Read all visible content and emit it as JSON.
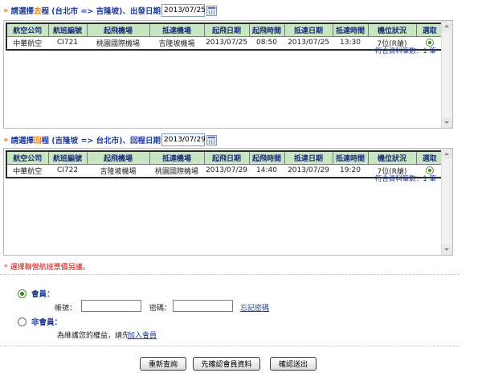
{
  "outbound": {
    "prefix": "請選擇",
    "highlight": "去",
    "suffix": "程 (台北市 => 吉隆坡)、出發日期",
    "date": "2013/07/25",
    "headers": [
      "航空公司",
      "航班編號",
      "起飛機場",
      "抵達機場",
      "起飛日期",
      "起飛時間",
      "抵達日期",
      "抵達時間",
      "機位狀況",
      "選取"
    ],
    "rows": [
      {
        "airline": "中華航空",
        "flight": "CI721",
        "from": "桃園國際機場",
        "to": "吉隆坡機場",
        "dep_date": "2013/07/25",
        "dep_time": "08:50",
        "arr_date": "2013/07/25",
        "arr_time": "13:30",
        "seats": "7位(R艙)"
      }
    ],
    "count_text": "符合資料筆數：1 筆"
  },
  "inbound": {
    "prefix": "請選擇",
    "highlight": "回",
    "suffix": "程 (吉隆坡 => 台北市)、回程日期",
    "date": "2013/07/29",
    "headers": [
      "航空公司",
      "航班編號",
      "起飛機場",
      "抵達機場",
      "起飛日期",
      "起飛時間",
      "抵達日期",
      "抵達時間",
      "機位狀況",
      "選取"
    ],
    "rows": [
      {
        "airline": "中華航空",
        "flight": "CI722",
        "from": "吉隆坡機場",
        "to": "桃園國際機場",
        "dep_date": "2013/07/29",
        "dep_time": "14:40",
        "arr_date": "2013/07/29",
        "arr_time": "19:20",
        "seats": "7位(R艙)"
      }
    ],
    "count_text": "符合資料筆數：1 筆"
  },
  "note": "選擇聯營航班票價另議。",
  "member": {
    "member_label": "會員：",
    "account_label": "帳號：",
    "password_label": "密碼：",
    "forgot_link": "忘記密碼",
    "nonmember_label": "非會員：",
    "nonmember_text": "為維護您的權益，請先",
    "join_link": "加入會員"
  },
  "buttons": {
    "requery": "重新查詢",
    "confirm_member": "先確認會員資料",
    "submit": "確認送出"
  },
  "colors": {
    "header_bg": "#c8e6c2",
    "title_blue": "#1f3c96",
    "accent_orange": "#ff7a00",
    "note_red": "#d30000"
  }
}
